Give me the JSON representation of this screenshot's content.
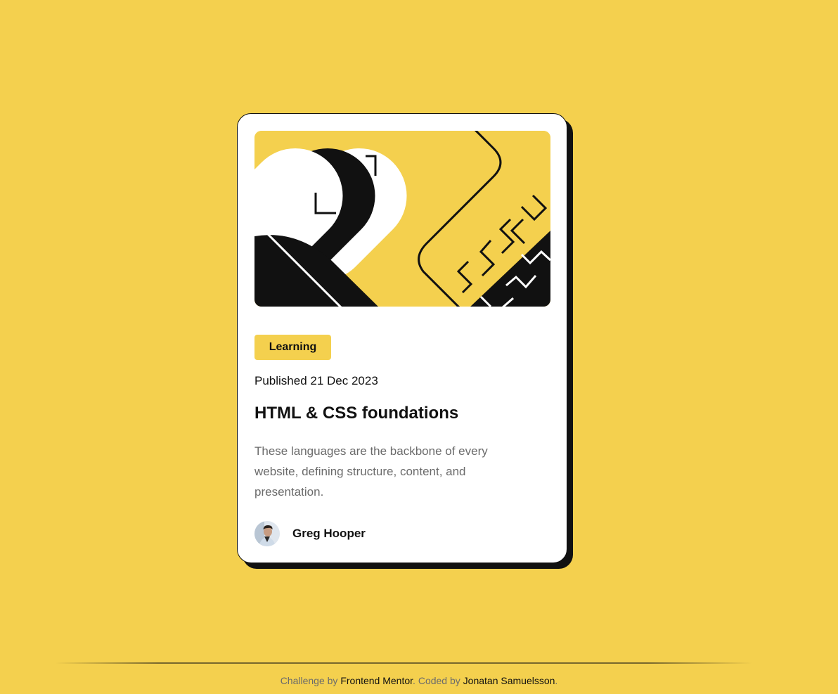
{
  "colors": {
    "background": "#f4d04e",
    "card": "#ffffff",
    "ink": "#111111",
    "muted": "#6b6b6b",
    "tag_bg": "#f4d04e"
  },
  "card": {
    "image_icon": "abstract-illustration",
    "tag": "Learning",
    "published": "Published 21 Dec 2023",
    "title": "HTML & CSS foundations",
    "description": "These languages are the backbone of every website, defining structure, content, and presentation.",
    "author": {
      "avatar_icon": "avatar-photo",
      "name": "Greg Hooper"
    }
  },
  "footer": {
    "challenge_prefix": "Challenge by",
    "challenge_link": "Frontend Mentor",
    "separator": ".",
    "coded_prefix": "Coded by",
    "coded_link": "Jonatan Samuelsson",
    "end": "."
  }
}
